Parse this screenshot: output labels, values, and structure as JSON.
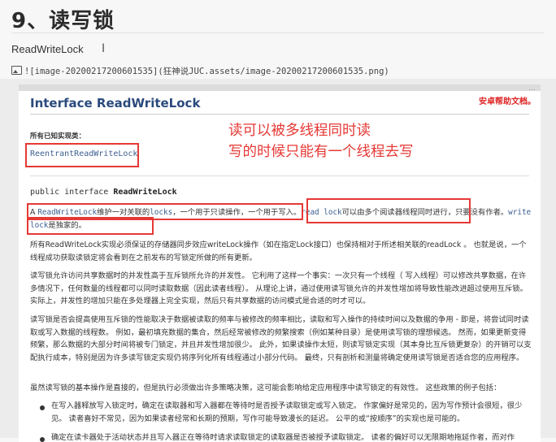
{
  "heading": "9、读写锁",
  "editor_line": "ReadWriteLock",
  "cursor_glyph": "I",
  "image_markdown": "![image-20200217200601535](狂神说JUC.assets/image-20200217200601535.png)",
  "doc": {
    "top_right_fragment": "...",
    "top_right_note": "安卓帮助文档。",
    "title": "Interface ReadWriteLock",
    "known_impl_label": "所有已知实现类：",
    "known_impl_link": "ReentrantReadWriteLock",
    "annotation_line1": "读可以被多线程同时读",
    "annotation_line2": "写的时候只能有一个线程去写",
    "declaration_prefix": "public interface ",
    "declaration_name": "ReadWriteLock",
    "para1_a": "A ",
    "para1_code1": "ReadWriteLock",
    "para1_b": "维护一对关联的",
    "para1_code2": "locks",
    "para1_c": "，一个用于只读操作，一个用于写入。",
    "para1_code3": "read lock",
    "para1_d": "可以由多个阅读器线程同时进行，只要没有作者。",
    "para1_code4": "write lock",
    "para1_e": "是独家的。",
    "para2": "所有ReadWriteLock实现必须保证的存储器同步效应writeLock操作（如在指定Lock接口）也保持相对于所述相关联的readLock 。 也就是说，一个线程成功获取读锁定将会看到在之前发布的写锁定所做的所有更新。",
    "para3": "读写锁允许访问共享数据时的并发性高于互斥锁所允许的并发性。 它利用了这样一个事实：一次只有一个线程（ 写入线程）可以修改共享数据，在许多情况下，任何数量的线程都可以同时读取数据（因此读者线程）。 从理论上讲，通过使用读写锁允许的并发性增加将导致性能改进超过使用互斥锁。 实际上，并发性的增加只能在多处理器上完全实现，然后只有共享数据的访问模式是合适的时才可以。",
    "para4": "读写锁是否会提高使用互斥锁的性能取决于数据被读取的频率与被修改的频率相比，读取和写入操作的持续时间以及数据的争用 - 即是，将尝试同时读取或写入数据的线程数。 例如，最初填充数据的集合，然后经常被修改的频繁搜索（例如某种目录）是使用读写锁的理想候选。 然而，如果更新变得频繁，那么数据的大部分时间将被专门锁定，并且并发性增加很少。 此外，如果读操作太短，则读写锁定实现（其本身比互斥锁更复杂）的开销可以支配执行成本，特别是因为许多读写锁定实现仍将序列化所有线程通过小部分代码。 最终，只有剖析和测量将确定使用读写锁是否适合您的应用程序。",
    "para5": "虽然读写锁的基本操作是直接的，但是执行必须做出许多策略决策，这可能会影响给定应用程序中读写锁定的有效性。 这些政策的例子包括：",
    "bullet1": "在写入器释放写入锁定时，确定在读取器和写入器都在等待时是否授予读取锁定或写入锁定。 作家偏好是常见的，因为写作预计会很短，很少见。 读者喜好不常见，因为如果读者经常和长期的预期，写作可能导致漫长的延迟。 公平的或“按顺序”的实现也是可能的。",
    "bullet2": "确定在读卡器处于活动状态并且写入器正在等待时请求读取锁定的读取器是否被授予读取锁定。 读者的偏好可以无限期地拖延作者，而对作"
  }
}
